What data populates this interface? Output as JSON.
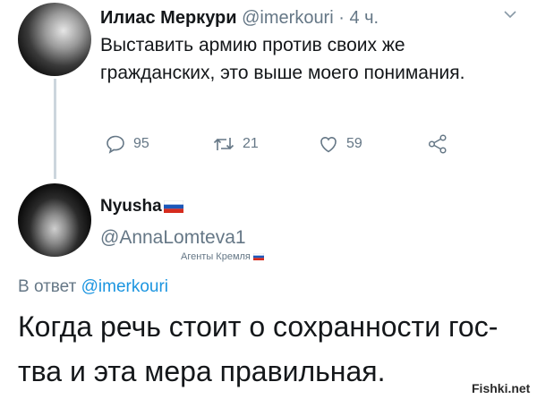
{
  "tweet1": {
    "author_name": "Илиас Меркури",
    "handle": "@imerkouri",
    "separator": " · ",
    "time": "4 ч.",
    "text": "Выставить армию против своих же гражданских, это выше моего понимания.",
    "actions": {
      "replies": "95",
      "retweets": "21",
      "likes": "59"
    }
  },
  "tweet2": {
    "author_name": "Nyusha",
    "handle": "@AnnaLomteva1",
    "badge": "Агенты Кремля",
    "reply_prefix": "В ответ ",
    "reply_handle": "@imerkouri",
    "text": "Когда речь стоит о сохранности гос-тва и эта мера правильная."
  },
  "watermark": "Fishki.net",
  "colors": {
    "text": "#14171a",
    "secondary": "#657786",
    "link": "#1b95e0",
    "thread_line": "#ccd6dd"
  },
  "icons": [
    "reply-icon",
    "retweet-icon",
    "like-icon",
    "share-icon",
    "chevron-down-icon",
    "russian-flag-icon"
  ]
}
